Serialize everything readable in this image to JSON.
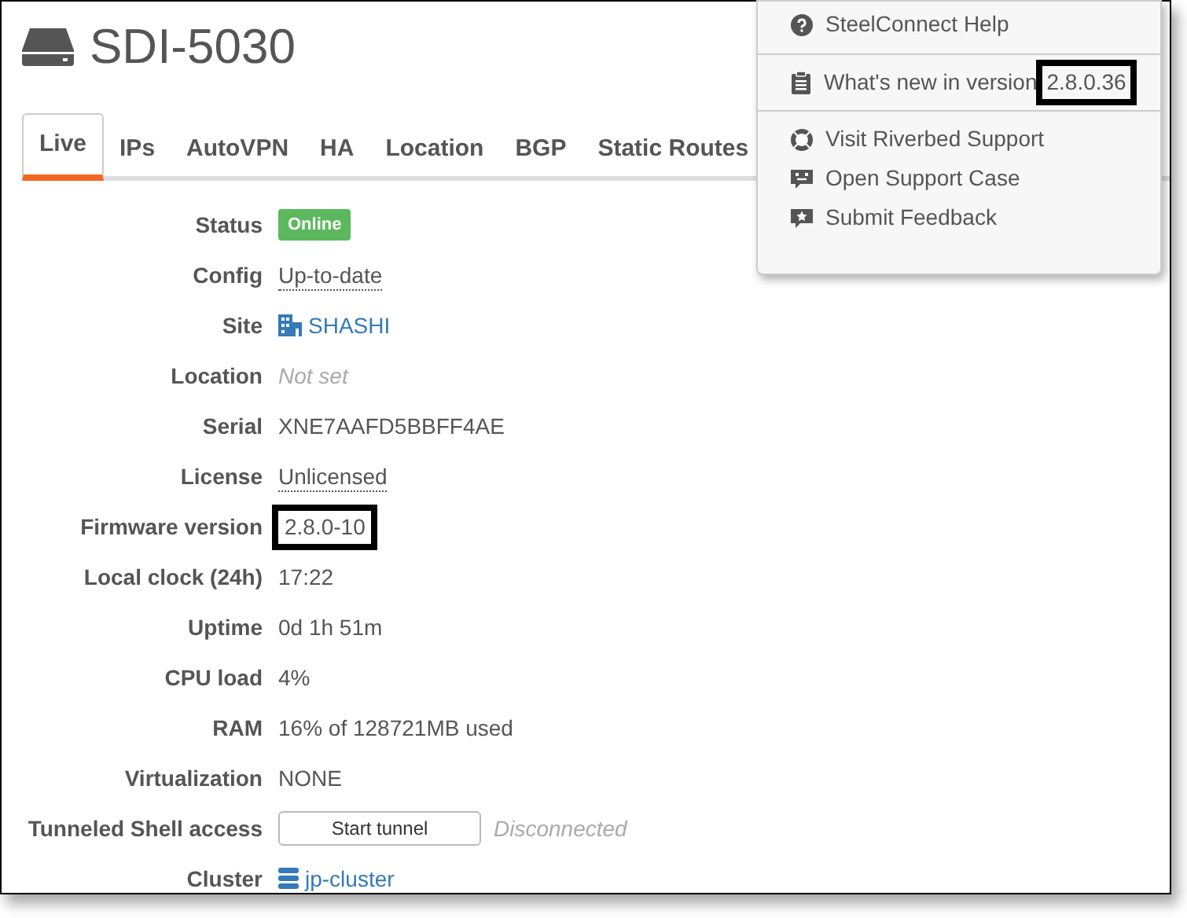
{
  "device": {
    "title": "SDI-5030"
  },
  "tabs": [
    {
      "label": "Live",
      "selected": true
    },
    {
      "label": "IPs",
      "selected": false
    },
    {
      "label": "AutoVPN",
      "selected": false
    },
    {
      "label": "HA",
      "selected": false
    },
    {
      "label": "Location",
      "selected": false
    },
    {
      "label": "BGP",
      "selected": false
    },
    {
      "label": "Static Routes",
      "selected": false
    }
  ],
  "details": [
    {
      "label": "Status",
      "kind": "badge",
      "value": "Online",
      "highlighted": false
    },
    {
      "label": "Config",
      "kind": "dotted",
      "value": "Up-to-date",
      "highlighted": false
    },
    {
      "label": "Site",
      "kind": "site",
      "value": "SHASHI",
      "highlighted": false
    },
    {
      "label": "Location",
      "kind": "unset",
      "value": "Not set",
      "highlighted": false
    },
    {
      "label": "Serial",
      "kind": "text",
      "value": "XNE7AAFD5BBFF4AE",
      "highlighted": false
    },
    {
      "label": "License",
      "kind": "dotted",
      "value": "Unlicensed",
      "highlighted": false
    },
    {
      "label": "Firmware version",
      "kind": "text",
      "value": "2.8.0-10",
      "highlighted": true
    },
    {
      "label": "Local clock (24h)",
      "kind": "text",
      "value": "17:22",
      "highlighted": false
    },
    {
      "label": "Uptime",
      "kind": "text",
      "value": "0d 1h 51m",
      "highlighted": false
    },
    {
      "label": "CPU load",
      "kind": "text",
      "value": "4%",
      "highlighted": false
    },
    {
      "label": "RAM",
      "kind": "text",
      "value": "16% of 128721MB used",
      "highlighted": false
    },
    {
      "label": "Virtualization",
      "kind": "text",
      "value": "NONE",
      "highlighted": false
    },
    {
      "label": "Tunneled Shell access",
      "kind": "tunnel",
      "button": "Start tunnel",
      "status": "Disconnected",
      "highlighted": false
    },
    {
      "label": "Cluster",
      "kind": "cluster",
      "value": "jp-cluster",
      "highlighted": false
    }
  ],
  "help_menu": {
    "groups": [
      [
        {
          "kind": "help",
          "label": "SteelConnect Help"
        }
      ],
      [
        {
          "kind": "whatsnew",
          "label": "What's new in version",
          "version": "2.8.0.36",
          "highlighted": true
        }
      ],
      [
        {
          "kind": "support",
          "label": "Visit Riverbed Support"
        },
        {
          "kind": "case",
          "label": "Open Support Case"
        },
        {
          "kind": "feedback",
          "label": "Submit Feedback"
        }
      ]
    ]
  }
}
